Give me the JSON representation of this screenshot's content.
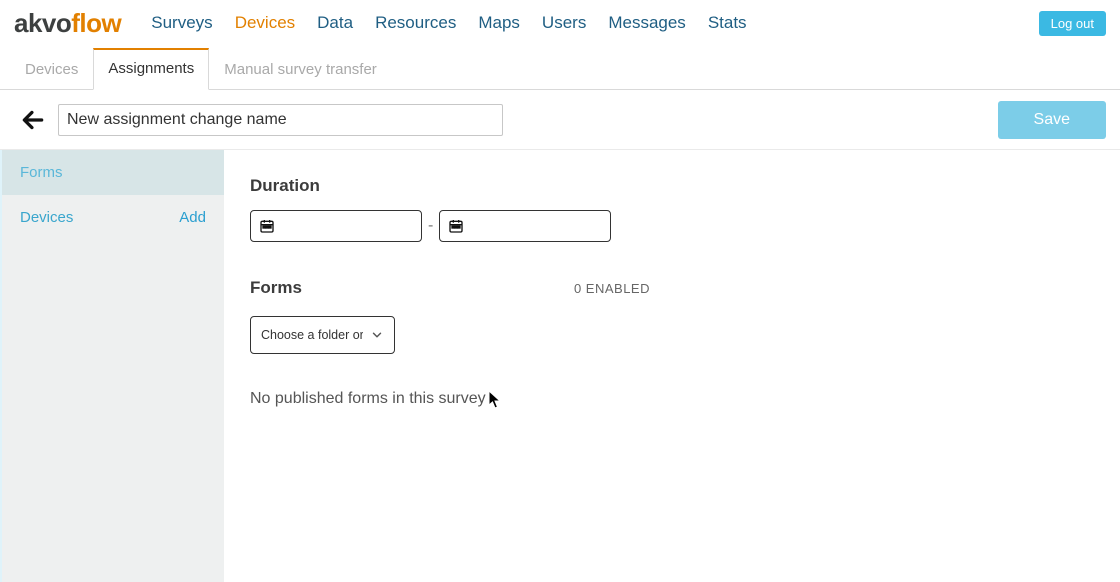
{
  "logo": {
    "part1": "akvo",
    "part2": "flow"
  },
  "nav": {
    "surveys": "Surveys",
    "devices": "Devices",
    "data": "Data",
    "resources": "Resources",
    "maps": "Maps",
    "users": "Users",
    "messages": "Messages",
    "stats": "Stats"
  },
  "logout_label": "Log out",
  "subtabs": {
    "devices": "Devices",
    "assignments": "Assignments",
    "manual_transfer": "Manual survey transfer"
  },
  "assignment": {
    "name_value": "New assignment change name",
    "save_label": "Save"
  },
  "sidebar": {
    "forms_label": "Forms",
    "devices_label": "Devices",
    "add_label": "Add"
  },
  "content": {
    "duration_title": "Duration",
    "forms_title": "Forms",
    "enabled_text": "0 ENABLED",
    "folder_select_label": "Choose a folder or sur",
    "empty_message": "No published forms in this survey"
  }
}
